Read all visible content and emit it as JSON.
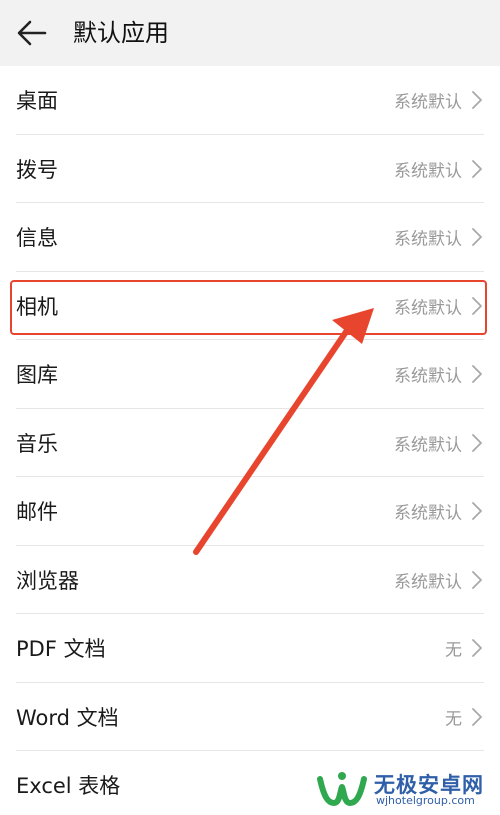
{
  "header": {
    "title": "默认应用",
    "back_icon": "arrow-left-icon"
  },
  "rows": [
    {
      "label": "桌面",
      "value": "系统默认"
    },
    {
      "label": "拨号",
      "value": "系统默认"
    },
    {
      "label": "信息",
      "value": "系统默认"
    },
    {
      "label": "相机",
      "value": "系统默认"
    },
    {
      "label": "图库",
      "value": "系统默认"
    },
    {
      "label": "音乐",
      "value": "系统默认"
    },
    {
      "label": "邮件",
      "value": "系统默认"
    },
    {
      "label": "浏览器",
      "value": "系统默认"
    },
    {
      "label": "PDF 文档",
      "value": "无"
    },
    {
      "label": "Word 文档",
      "value": "无"
    },
    {
      "label": "Excel 表格",
      "value": ""
    }
  ],
  "annotation": {
    "highlighted_row": "相机",
    "color": "#e8452e"
  },
  "watermark": {
    "title": "无极安卓网",
    "url": "wjhotelgroup.com"
  }
}
